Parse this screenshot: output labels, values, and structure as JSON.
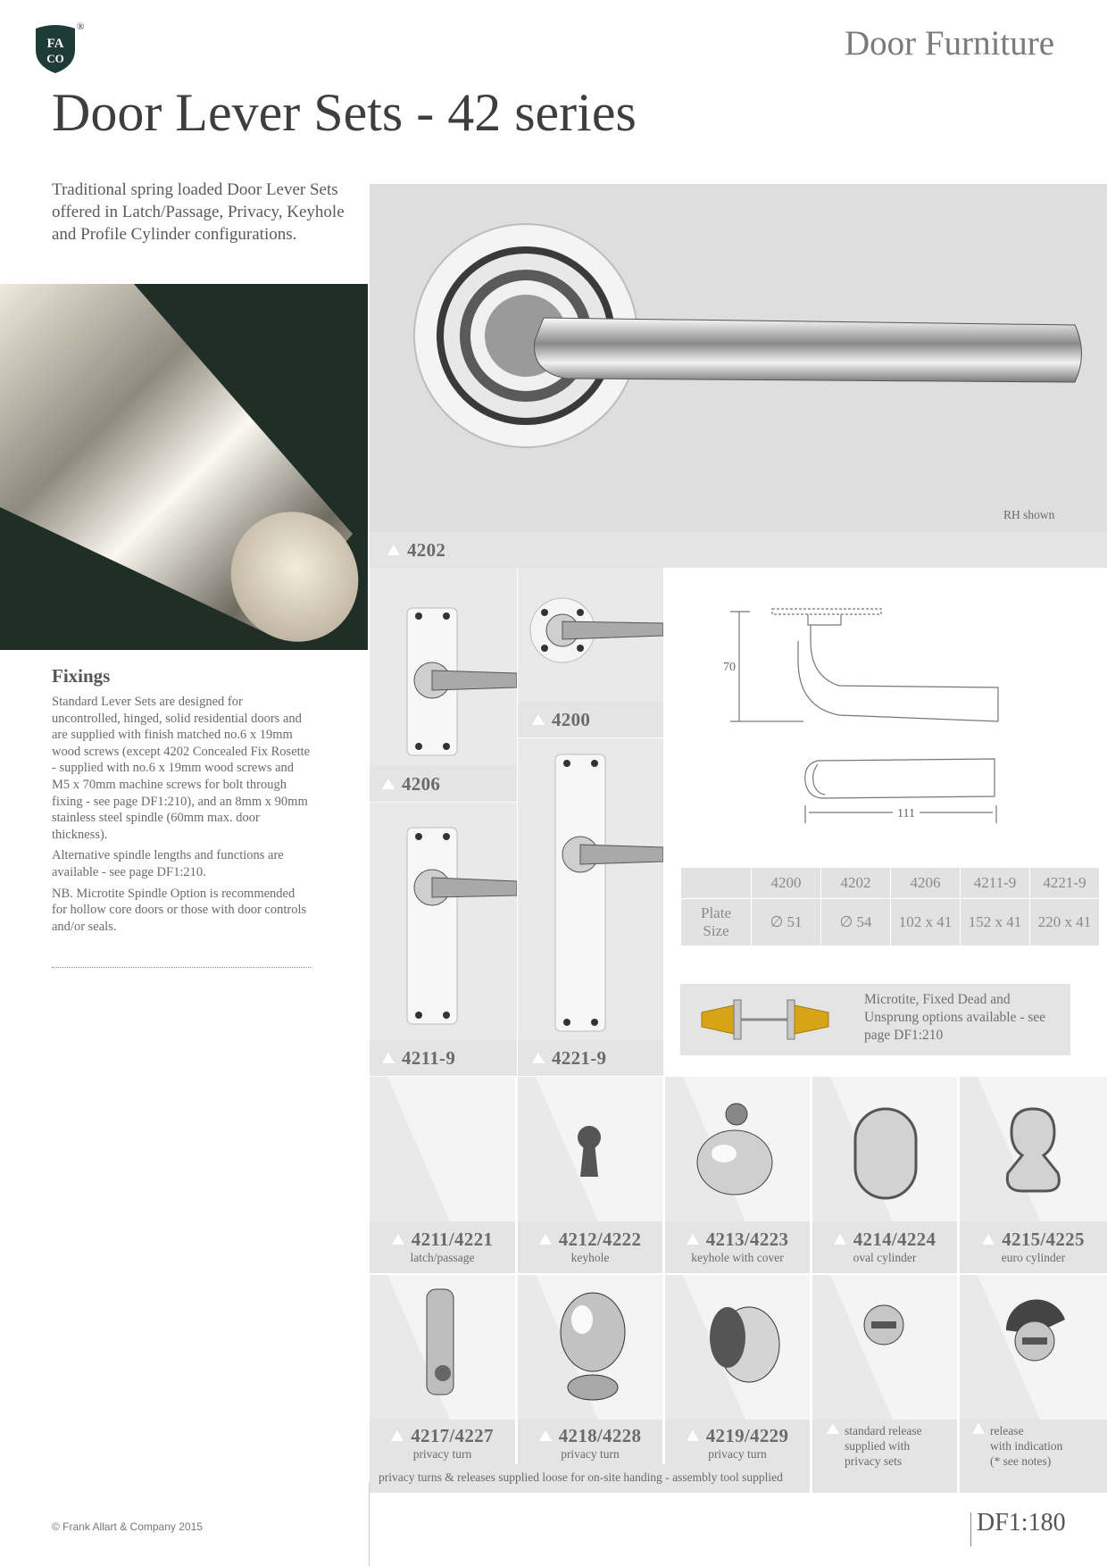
{
  "logo": {
    "line1": "FA",
    "line2": "CO",
    "registered": "®"
  },
  "header": {
    "section": "Door Furniture",
    "title": "Door Lever Sets - 42 series"
  },
  "intro": "Traditional spring loaded Door Lever Sets offered in Latch/Passage, Privacy, Keyhole and Profile Cylinder configurations.",
  "fixings": {
    "title": "Fixings",
    "p1": "Standard Lever Sets are designed for uncontrolled, hinged, solid residential doors and are supplied with finish matched no.6 x 19mm wood screws (except 4202 Concealed Fix Rosette - supplied with no.6 x 19mm wood screws and M5 x 70mm machine screws for bolt through fixing - see page DF1:210), and an 8mm x 90mm stainless steel spindle (60mm max. door thickness).",
    "p2": "Alternative spindle lengths and functions are available - see page DF1:210.",
    "p3": "NB. Microtite Spindle Option is recommended for hollow core doors or those with door controls and/or seals."
  },
  "main_product": {
    "code": "4202",
    "note": "RH shown"
  },
  "products": [
    {
      "code": "4206"
    },
    {
      "code": "4200"
    },
    {
      "code": "4211-9"
    },
    {
      "code": "4221-9"
    }
  ],
  "diagram": {
    "height_label": "70",
    "width_label": "111"
  },
  "spec_table": {
    "headers": [
      "4200",
      "4202",
      "4206",
      "4211-9",
      "4221-9"
    ],
    "row_label": "Plate Size",
    "values": [
      "∅ 51",
      "∅ 54",
      "102 x 41",
      "152 x 41",
      "220 x 41"
    ]
  },
  "microtite": "Microtite, Fixed Dead and Unsprung options available - see page DF1:210",
  "functions_row1": [
    {
      "code": "4211/4221",
      "label": "latch/passage"
    },
    {
      "code": "4212/4222",
      "label": "keyhole"
    },
    {
      "code": "4213/4223",
      "label": "keyhole with cover"
    },
    {
      "code": "4214/4224",
      "label": "oval cylinder"
    },
    {
      "code": "4215/4225",
      "label": "euro cylinder"
    }
  ],
  "functions_row2": [
    {
      "code": "4217/4227",
      "label": "privacy turn"
    },
    {
      "code": "4218/4228",
      "label": "privacy turn"
    },
    {
      "code": "4219/4229",
      "label": "privacy turn"
    },
    {
      "code": "",
      "label_l1": "standard release",
      "label_l2": "supplied with",
      "label_l3": "privacy sets"
    },
    {
      "code": "",
      "label_l1": "release",
      "label_l2": "with indication",
      "label_l3": "(* see notes)"
    }
  ],
  "bottom_note": "privacy turns & releases supplied loose for on-site handing - assembly tool supplied",
  "footer": {
    "copyright": "© Frank Allart & Company 2015",
    "page": "DF1:180"
  }
}
